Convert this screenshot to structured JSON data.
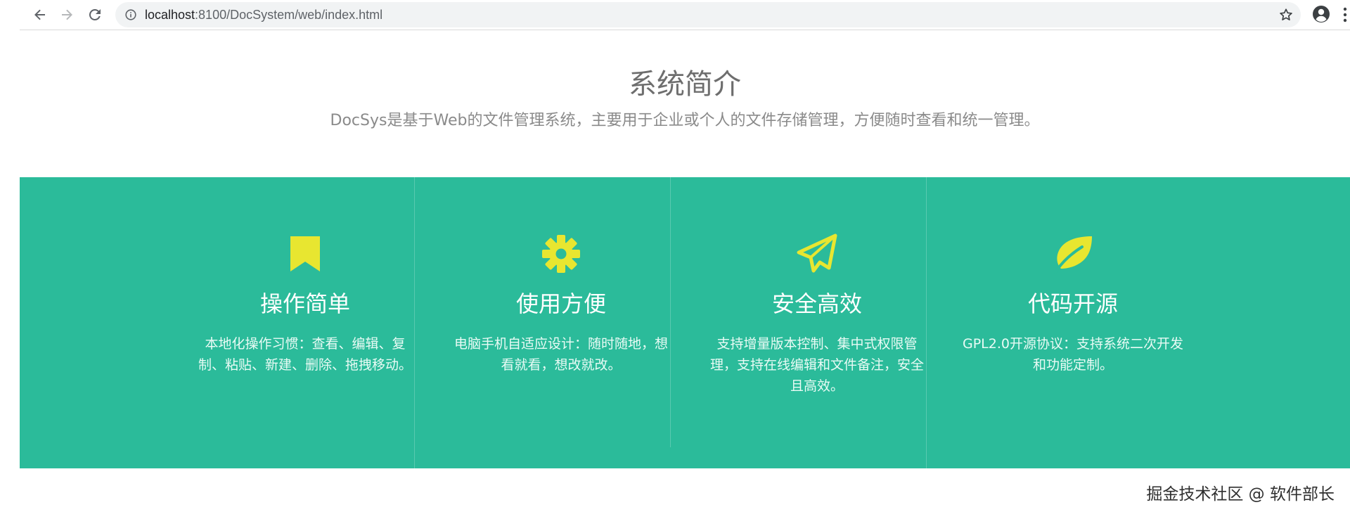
{
  "browser": {
    "url_host": "localhost",
    "url_path": ":8100/DocSystem/web/index.html"
  },
  "intro": {
    "title": "系统简介",
    "subtitle": "DocSys是基于Web的文件管理系统，主要用于企业或个人的文件存储管理，方便随时查看和统一管理。"
  },
  "colors": {
    "feature_background": "#2bbb9a",
    "icon_accent": "#e8e630",
    "title_text": "#6e6e6e"
  },
  "features": [
    {
      "icon": "bookmark-icon",
      "title": "操作简单",
      "description": "本地化操作习惯：查看、编辑、复制、粘贴、新建、删除、拖拽移动。"
    },
    {
      "icon": "gear-icon",
      "title": "使用方便",
      "description": "电脑手机自适应设计：随时随地，想看就看，想改就改。"
    },
    {
      "icon": "paper-plane-icon",
      "title": "安全高效",
      "description": "支持增量版本控制、集中式权限管理，支持在线编辑和文件备注，安全且高效。"
    },
    {
      "icon": "leaf-icon",
      "title": "代码开源",
      "description": "GPL2.0开源协议：支持系统二次开发和功能定制。"
    }
  ],
  "watermark": "掘金技术社区 @ 软件部长"
}
